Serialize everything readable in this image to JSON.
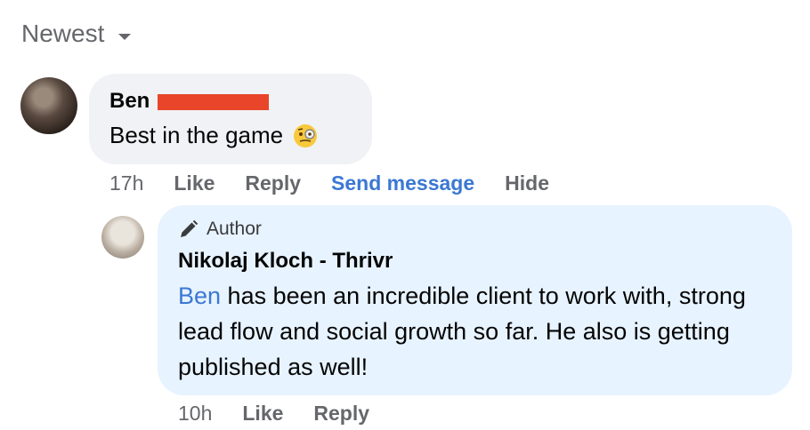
{
  "sort": {
    "label": "Newest",
    "icon": "caret-down-icon"
  },
  "comment": {
    "author": "Ben",
    "text": "Best in the game",
    "emoji": "monocle-face-emoji",
    "time": "17h",
    "actions": {
      "like": "Like",
      "reply": "Reply",
      "send_message": "Send message",
      "hide": "Hide"
    }
  },
  "reply": {
    "badge": "Author",
    "badge_icon": "pencil-icon",
    "author": "Nikolaj Kloch - Thrivr",
    "mention": "Ben",
    "text": " has been an incredible client to work with, strong lead flow and social growth so far. He also is getting published as well!",
    "time": "10h",
    "actions": {
      "like": "Like",
      "reply": "Reply"
    }
  },
  "colors": {
    "link": "#3b78d3",
    "bubble": "#f0f2f5",
    "reply_bubble": "#e7f3ff",
    "redaction": "#e8452b"
  }
}
